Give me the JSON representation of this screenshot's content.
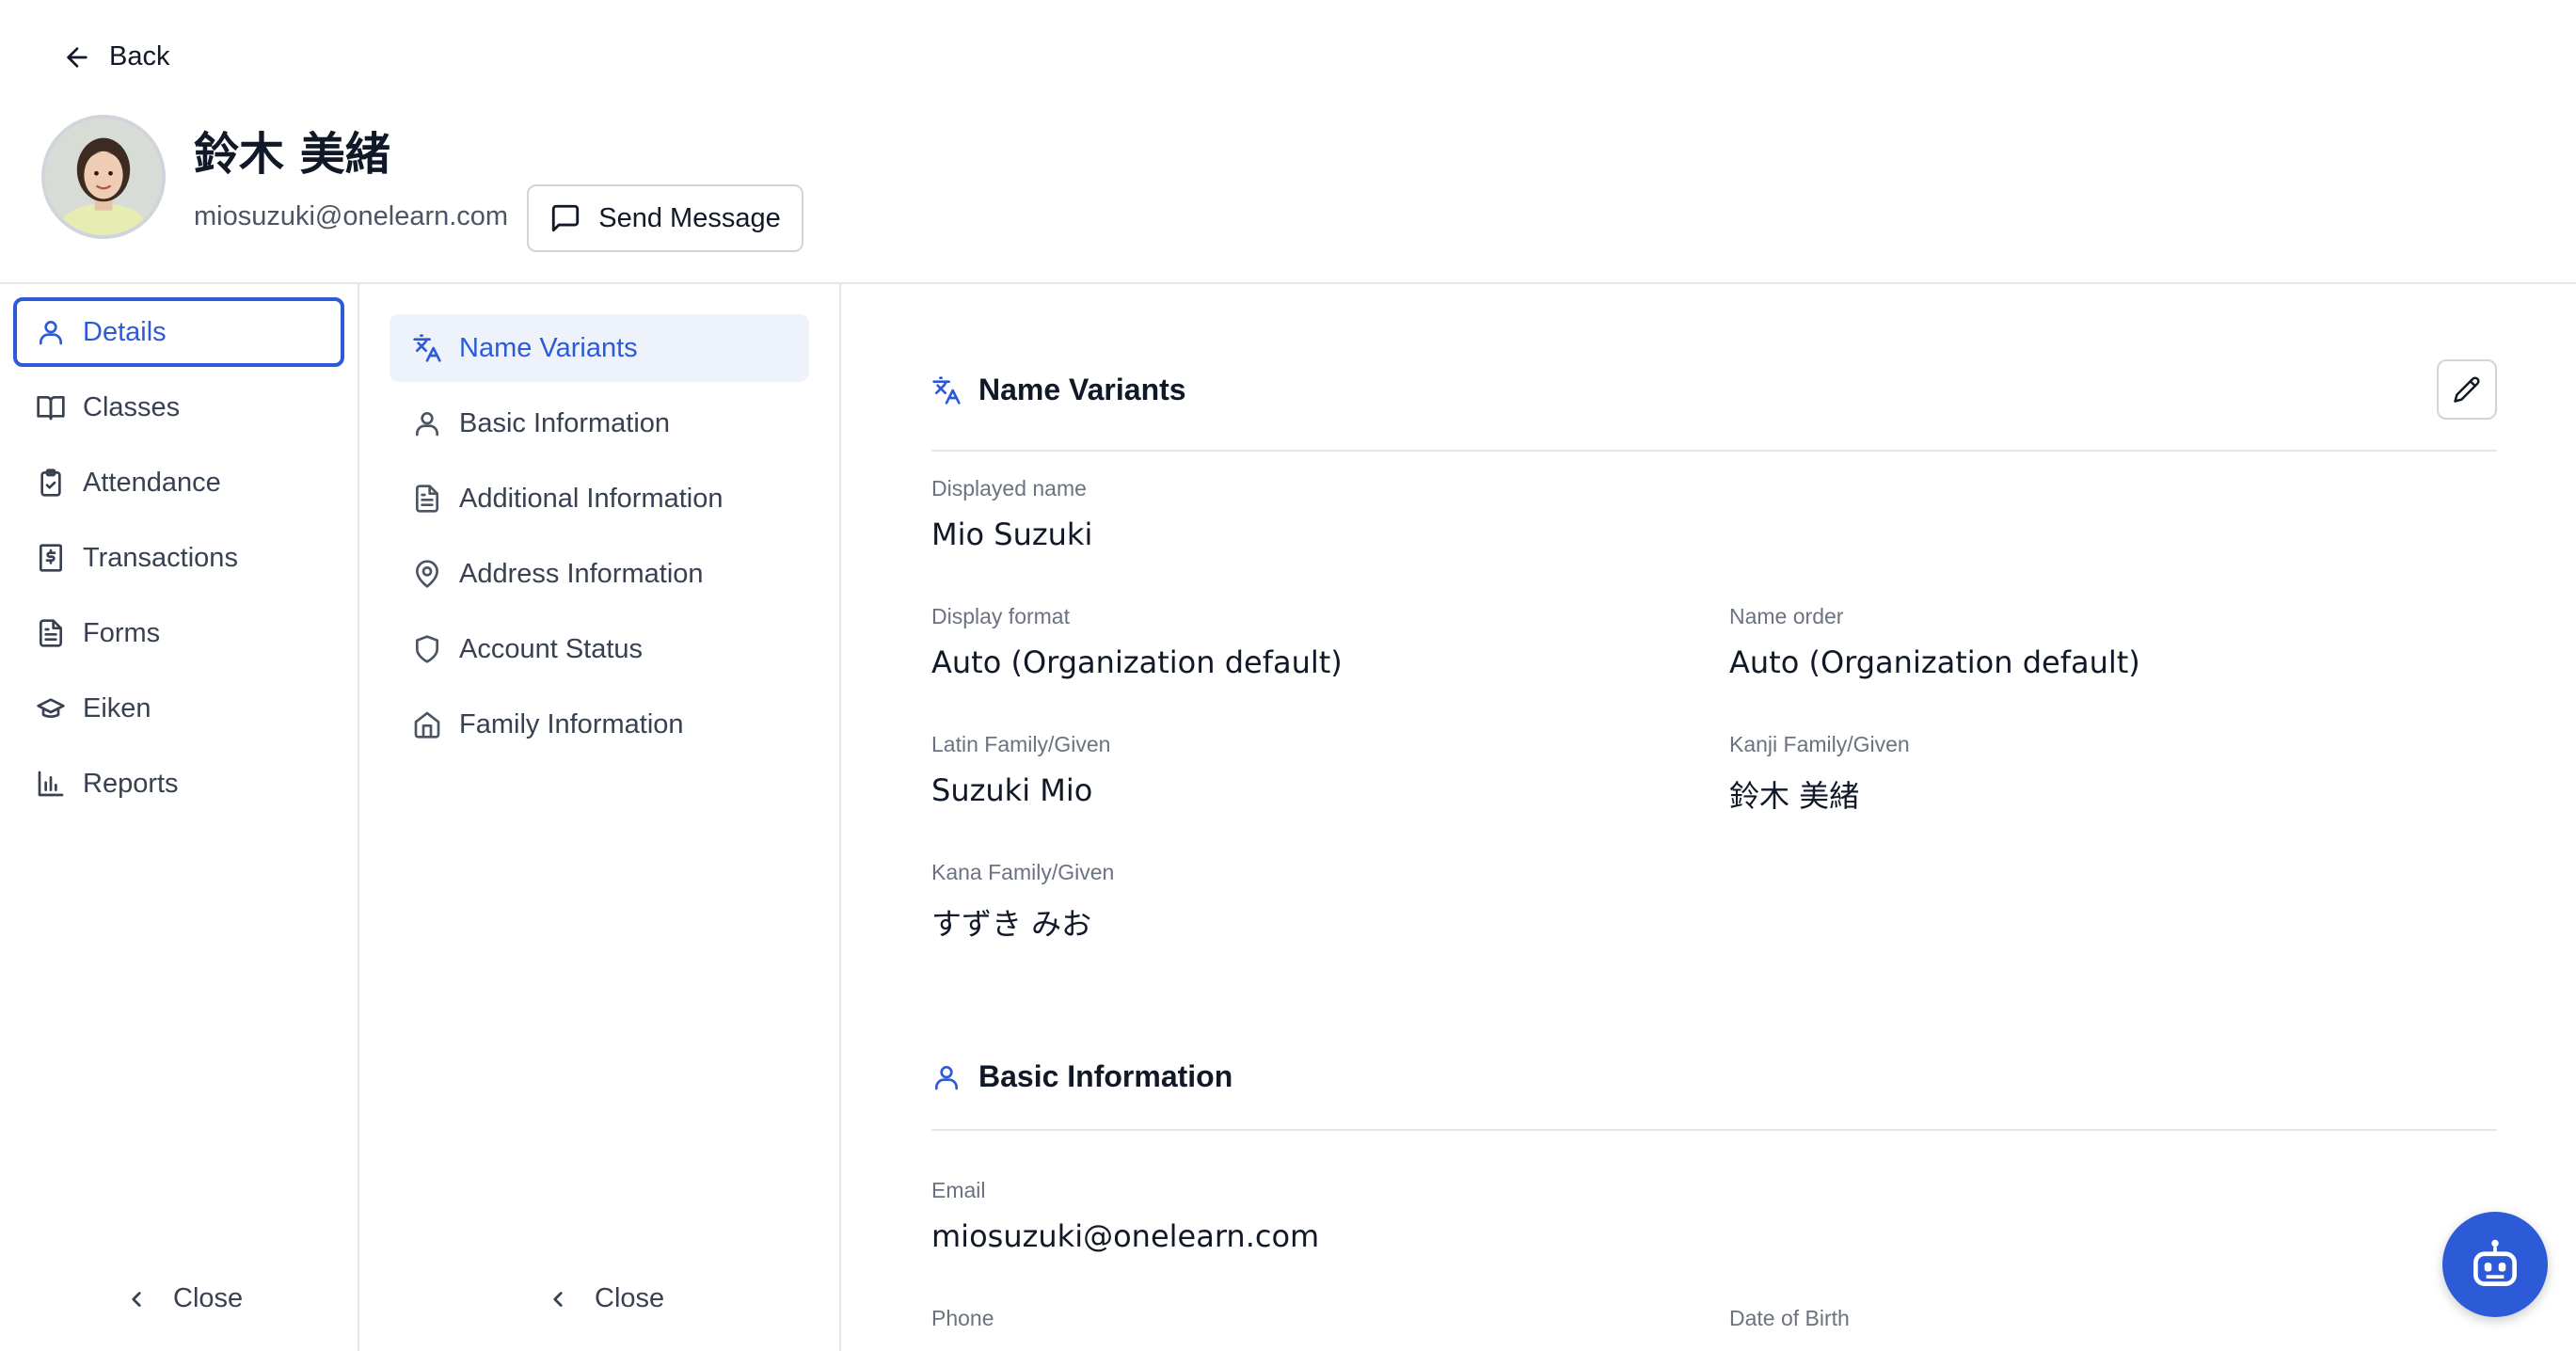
{
  "header": {
    "back_label": "Back",
    "user_name": "鈴木 美緒",
    "user_email": "miosuzuki@onelearn.com",
    "send_message_label": "Send Message"
  },
  "primary_nav": {
    "items": [
      {
        "label": "Details",
        "icon": "user-icon",
        "active": true
      },
      {
        "label": "Classes",
        "icon": "book-icon"
      },
      {
        "label": "Attendance",
        "icon": "clipboard-check-icon"
      },
      {
        "label": "Transactions",
        "icon": "receipt-dollar-icon"
      },
      {
        "label": "Forms",
        "icon": "file-text-icon"
      },
      {
        "label": "Eiken",
        "icon": "graduation-cap-icon"
      },
      {
        "label": "Reports",
        "icon": "bar-chart-icon"
      }
    ],
    "close_label": "Close"
  },
  "secondary_nav": {
    "items": [
      {
        "label": "Name Variants",
        "icon": "translate-icon",
        "active": true
      },
      {
        "label": "Basic Information",
        "icon": "user-icon"
      },
      {
        "label": "Additional Information",
        "icon": "file-text-icon"
      },
      {
        "label": "Address Information",
        "icon": "map-pin-icon"
      },
      {
        "label": "Account Status",
        "icon": "shield-icon"
      },
      {
        "label": "Family Information",
        "icon": "home-icon"
      }
    ],
    "close_label": "Close"
  },
  "name_variants": {
    "title": "Name Variants",
    "displayed_name": {
      "label": "Displayed name",
      "value": "Mio Suzuki"
    },
    "display_format": {
      "label": "Display format",
      "value": "Auto (Organization default)"
    },
    "name_order": {
      "label": "Name order",
      "value": "Auto (Organization default)"
    },
    "latin": {
      "label": "Latin Family/Given",
      "value": "Suzuki Mio"
    },
    "kanji": {
      "label": "Kanji Family/Given",
      "value": "鈴木 美緒"
    },
    "kana": {
      "label": "Kana Family/Given",
      "value": "すずき みお"
    }
  },
  "basic_info": {
    "title": "Basic Information",
    "email": {
      "label": "Email",
      "value": "miosuzuki@onelearn.com"
    },
    "phone": {
      "label": "Phone"
    },
    "dob": {
      "label": "Date of Birth"
    }
  },
  "colors": {
    "accent": "#2d5bd8",
    "active_bg": "#eef2fb",
    "border": "#e5e7eb",
    "muted_text": "#6b7280"
  }
}
